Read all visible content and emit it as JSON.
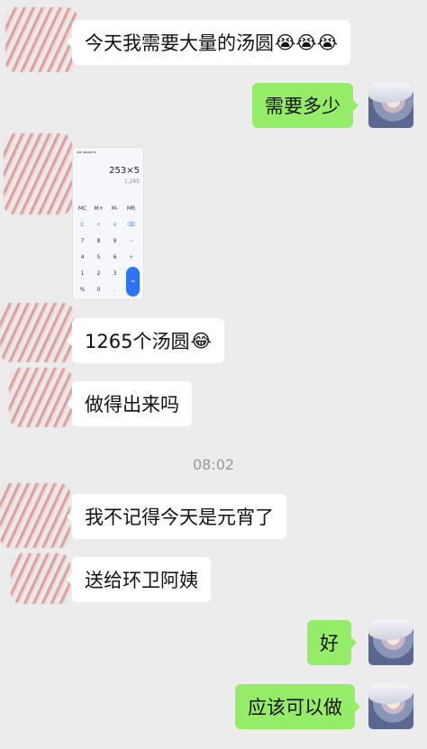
{
  "messages": [
    {
      "text": "今天我需要大量的汤圆",
      "emoji": "😭😭😭"
    },
    {
      "text": "需要多少"
    },
    {
      "text": "1265个汤圆",
      "emoji": "😂"
    },
    {
      "text": "做得出来吗"
    },
    {
      "text": "我不记得今天是元宵了"
    },
    {
      "text": "送给环卫阿姨"
    },
    {
      "text": "好"
    },
    {
      "text": "应该可以做"
    }
  ],
  "timestamp": "08:02",
  "calculator": {
    "expression": "253×5",
    "result": "1,265",
    "keys": [
      "MC",
      "M+",
      "M-",
      "MR",
      "C",
      "÷",
      "×",
      "⌫",
      "7",
      "8",
      "9",
      "−",
      "4",
      "5",
      "6",
      "+",
      "1",
      "2",
      "3",
      "%",
      "0",
      ".",
      "="
    ]
  },
  "colors": {
    "background": "#ececec",
    "incoming_bubble": "#ffffff",
    "outgoing_bubble": "#95ec69",
    "calc_accent": "#2e73f6"
  }
}
